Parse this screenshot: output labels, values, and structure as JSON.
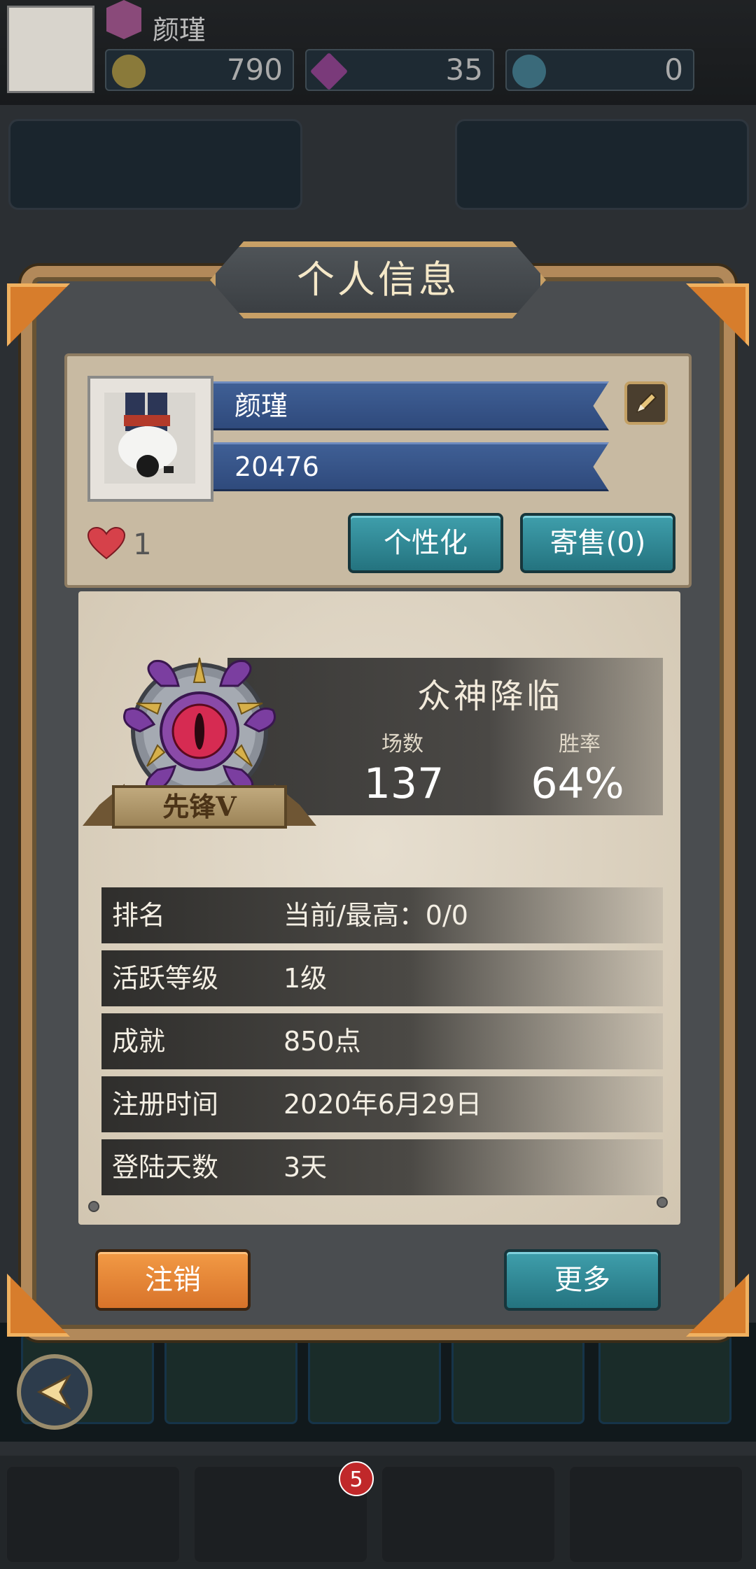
{
  "background": {
    "player_name": "颜瑾",
    "resources": [
      {
        "name": "gold-coin-icon",
        "value": "790"
      },
      {
        "name": "gem-icon",
        "value": "35"
      },
      {
        "name": "orb-icon",
        "value": "0"
      }
    ],
    "notification_badge": "5"
  },
  "dialog": {
    "title": "个人信息",
    "profile": {
      "name": "颜瑾",
      "id": "20476",
      "likes": "1"
    },
    "buttons": {
      "customize": "个性化",
      "consign": "寄售(0)",
      "logout": "注销",
      "more": "更多"
    },
    "season": {
      "title": "众神降临",
      "rank_badge": "先锋V",
      "matches_label": "场数",
      "matches_value": "137",
      "winrate_label": "胜率",
      "winrate_value": "64%"
    },
    "info_rows": [
      {
        "label": "排名",
        "value": "当前/最高：0/0"
      },
      {
        "label": "活跃等级",
        "value": "1级"
      },
      {
        "label": "成就",
        "value": "850点"
      },
      {
        "label": "注册时间",
        "value": "2020年6月29日"
      },
      {
        "label": "登陆天数",
        "value": "3天"
      }
    ]
  },
  "colors": {
    "frame": "#b2895a",
    "accent_orange": "#d77d2c",
    "teal_button": "#2e8c98",
    "ribbon_blue": "#3a5890"
  }
}
